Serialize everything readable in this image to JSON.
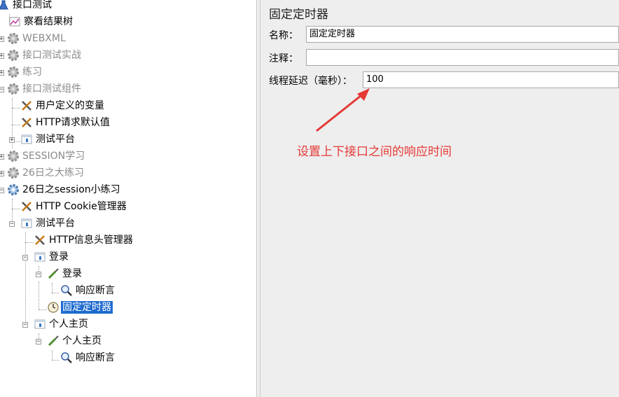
{
  "tree": {
    "items": [
      {
        "label": "接口测试",
        "icon": "flask-icon",
        "disabled": false
      },
      {
        "label": "察看结果树",
        "icon": "chart-icon",
        "disabled": false
      },
      {
        "label": "WEBXML",
        "icon": "gear-icon",
        "disabled": true
      },
      {
        "label": "接口测试实战",
        "icon": "gear-icon",
        "disabled": true
      },
      {
        "label": "练习",
        "icon": "gear-icon",
        "disabled": true
      },
      {
        "label": "接口测试组件",
        "icon": "gear-icon",
        "disabled": true
      },
      {
        "label": "用户定义的变量",
        "icon": "wrench-icon",
        "disabled": false
      },
      {
        "label": "HTTP请求默认值",
        "icon": "wrench-icon",
        "disabled": false
      },
      {
        "label": "测试平台",
        "icon": "controller-icon",
        "disabled": false
      },
      {
        "label": "SESSION学习",
        "icon": "gear-icon",
        "disabled": true
      },
      {
        "label": "26日之大练习",
        "icon": "gear-icon",
        "disabled": true
      },
      {
        "label": "26日之session小练习",
        "icon": "gear-icon",
        "disabled": false
      },
      {
        "label": "HTTP Cookie管理器",
        "icon": "wrench-icon",
        "disabled": false
      },
      {
        "label": "测试平台",
        "icon": "controller-icon",
        "disabled": false
      },
      {
        "label": "HTTP信息头管理器",
        "icon": "wrench-icon",
        "disabled": false
      },
      {
        "label": "登录",
        "icon": "controller-icon",
        "disabled": false
      },
      {
        "label": "登录",
        "icon": "pipette-icon",
        "disabled": false
      },
      {
        "label": "响应断言",
        "icon": "magnifier-icon",
        "disabled": false
      },
      {
        "label": "固定定时器",
        "icon": "clock-icon",
        "disabled": false,
        "selected": true
      },
      {
        "label": "个人主页",
        "icon": "controller-icon",
        "disabled": false
      },
      {
        "label": "个人主页",
        "icon": "pipette-icon",
        "disabled": false
      },
      {
        "label": "响应断言",
        "icon": "magnifier-icon",
        "disabled": false
      }
    ]
  },
  "form": {
    "title": "固定定时器",
    "name_label": "名称：",
    "name_value": "固定定时器",
    "comment_label": "注释：",
    "comment_value": "",
    "delay_label": "线程延迟（毫秒）：",
    "delay_value": "100"
  },
  "annotation": {
    "text": "设置上下接口之间的响应时间",
    "color": "#e53935"
  },
  "colors": {
    "selection": "#1e6bd0",
    "panel_bg": "#eeeeee",
    "disabled_text": "#8a8a8a"
  }
}
